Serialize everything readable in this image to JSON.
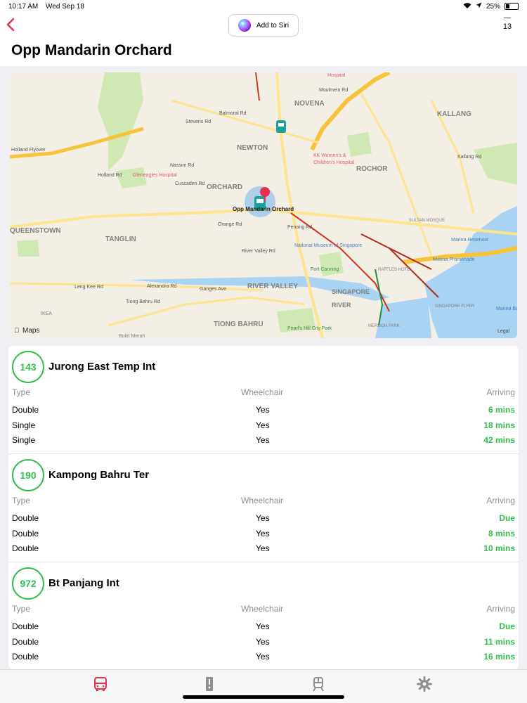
{
  "status_bar": {
    "time": "10:17 AM",
    "date": "Wed Sep 18",
    "battery": "25%"
  },
  "nav": {
    "siri_label": "Add to Siri",
    "calendar_day": "13"
  },
  "page": {
    "title": "Opp Mandarin Orchard"
  },
  "map": {
    "brand": "Maps",
    "legal": "Legal",
    "pin_label": "Opp Mandarin Orchard",
    "labels": [
      "NOVENA",
      "KALLANG",
      "NEWTON",
      "ROCHOR",
      "ORCHARD",
      "TANGLIN",
      "QUEENSTOWN",
      "RIVER VALLEY",
      "SINGAPORE RIVER",
      "TIONG BAHRU",
      "Hospital",
      "KK Women's & Children's Hospital",
      "Gleneagles Hospital",
      "National Museum of Singapore",
      "Fort Canning",
      "Marina Reservoir",
      "Marina Promenade",
      "Marina Bay",
      "SULTAN MOSQUE",
      "RAFFLES HOTEL",
      "SINGAPORE FLYER",
      "Pearl's Hill City Park",
      "MERLION PARK",
      "IKEA",
      "Holland Flyover",
      "Holland Rd",
      "Orange Rd",
      "Penang Rd",
      "River Valley Rd",
      "Alexandra Rd",
      "Ganges Ave",
      "Leng Kee Rd",
      "Tiong Bahru Rd",
      "Balmoral Rd",
      "Stevens Rd",
      "Moulmein Rd",
      "Kallang Rd",
      "Nassim Rd",
      "Cuscaden Rd",
      "Bukit Merah"
    ],
    "colors": {
      "land": "#f4efe4",
      "park": "#cfe8b4",
      "water": "#a9d3f2",
      "road": "#fde48e",
      "highway": "#f7c33b"
    }
  },
  "columns": {
    "type": "Type",
    "wheelchair": "Wheelchair",
    "arriving": "Arriving"
  },
  "services": [
    {
      "route": "143",
      "destination": "Jurong East Temp Int",
      "buses": [
        {
          "type": "Double",
          "wheelchair": "Yes",
          "arriving": "6 mins"
        },
        {
          "type": "Single",
          "wheelchair": "Yes",
          "arriving": "18 mins"
        },
        {
          "type": "Single",
          "wheelchair": "Yes",
          "arriving": "42 mins"
        }
      ]
    },
    {
      "route": "190",
      "destination": "Kampong Bahru Ter",
      "buses": [
        {
          "type": "Double",
          "wheelchair": "Yes",
          "arriving": "Due"
        },
        {
          "type": "Double",
          "wheelchair": "Yes",
          "arriving": "8 mins"
        },
        {
          "type": "Double",
          "wheelchair": "Yes",
          "arriving": "10 mins"
        }
      ]
    },
    {
      "route": "972",
      "destination": "Bt Panjang Int",
      "buses": [
        {
          "type": "Double",
          "wheelchair": "Yes",
          "arriving": "Due"
        },
        {
          "type": "Double",
          "wheelchair": "Yes",
          "arriving": "11 mins"
        },
        {
          "type": "Double",
          "wheelchair": "Yes",
          "arriving": "16 mins"
        }
      ]
    }
  ],
  "tabs": [
    {
      "icon": "bus-icon",
      "active": true
    },
    {
      "icon": "bus-stop-icon",
      "active": false
    },
    {
      "icon": "train-icon",
      "active": false
    },
    {
      "icon": "gear-icon",
      "active": false
    }
  ],
  "accent": "#e8304b",
  "arrival_color": "#2fbf4a"
}
